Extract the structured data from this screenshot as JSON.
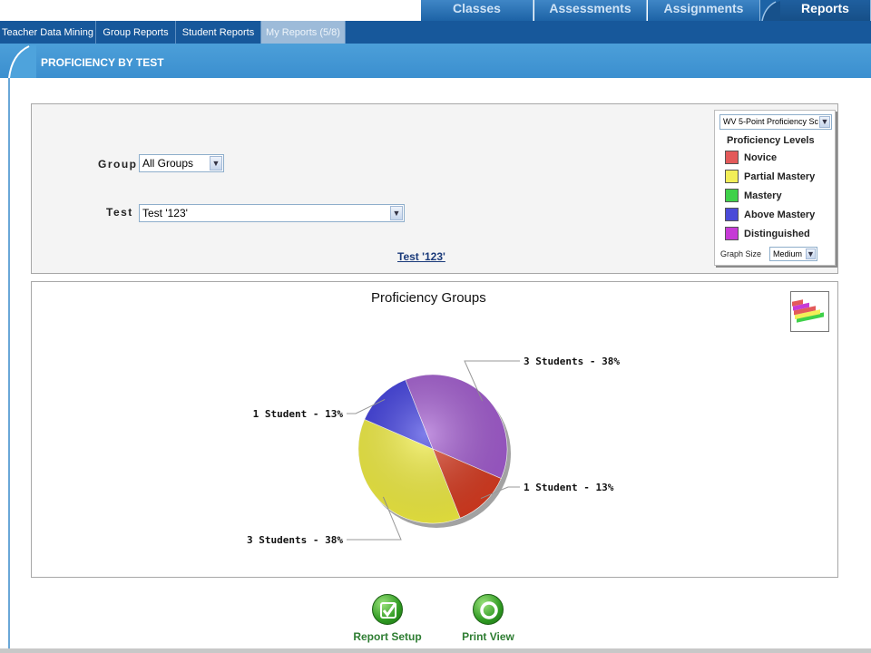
{
  "nav": {
    "tabs": [
      {
        "label": "Classes"
      },
      {
        "label": "Assessments"
      },
      {
        "label": "Assignments"
      },
      {
        "label": "Reports",
        "active": true
      }
    ]
  },
  "subnav": {
    "tabs": [
      {
        "label": "Teacher Data Mining"
      },
      {
        "label": "Group Reports"
      },
      {
        "label": "Student Reports"
      },
      {
        "label": "My Reports (5/8)",
        "active": true
      }
    ]
  },
  "page": {
    "title": "PROFICIENCY BY TEST"
  },
  "filters": {
    "group_label": "Group",
    "group_value": "All Groups",
    "test_label": "Test",
    "test_value": "Test '123'",
    "test_link": "Test '123'"
  },
  "legend": {
    "scale_value": "WV 5-Point Proficiency Sc",
    "title": "Proficiency Levels",
    "items": [
      {
        "label": "Novice",
        "color": "#e35a5a"
      },
      {
        "label": "Partial Mastery",
        "color": "#f2ee58"
      },
      {
        "label": "Mastery",
        "color": "#3fd14a"
      },
      {
        "label": "Above Mastery",
        "color": "#4b4bd8"
      },
      {
        "label": "Distinguished",
        "color": "#c63ad6"
      }
    ],
    "graph_size_label": "Graph Size",
    "graph_size_value": "Medium"
  },
  "chart": {
    "title": "Proficiency Groups",
    "icon": "chart-type-icon"
  },
  "chart_data": {
    "type": "pie",
    "title": "Proficiency Groups",
    "slices": [
      {
        "level": "Distinguished",
        "students": 3,
        "percent": 38,
        "label": "3 Students - 38%",
        "color": "#a25ad0"
      },
      {
        "level": "Novice",
        "students": 1,
        "percent": 13,
        "label": "1 Student - 13%",
        "color": "#d93a1f"
      },
      {
        "level": "Partial Mastery",
        "students": 3,
        "percent": 38,
        "label": "3 Students - 38%",
        "color": "#f3ef40"
      },
      {
        "level": "Above Mastery",
        "students": 1,
        "percent": 13,
        "label": "1 Student - 13%",
        "color": "#3b3ae0"
      }
    ]
  },
  "actions": {
    "report_setup": "Report Setup",
    "print_view": "Print View"
  }
}
